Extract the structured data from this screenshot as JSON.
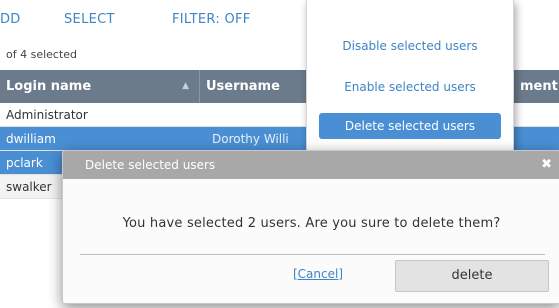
{
  "toolbar": {
    "add_label": "DD",
    "select_label": "SELECT",
    "filter_label": "FILTER: OFF"
  },
  "selection": {
    "count_text": "of 4 selected"
  },
  "table": {
    "columns": [
      "Login name",
      "Username",
      "ment"
    ],
    "sort_indicator": "▲",
    "rows": [
      {
        "login": "Administrator",
        "username": ""
      },
      {
        "login": "dwilliam",
        "username": "Dorothy Willi"
      },
      {
        "login": "pclark",
        "username": ""
      },
      {
        "login": "swalker",
        "username": ""
      }
    ]
  },
  "dropdown": {
    "items": [
      "Disable selected users",
      "Enable selected users",
      "Delete selected users"
    ]
  },
  "modal": {
    "title": "Delete selected users",
    "close_glyph": "✖",
    "message": "You have selected 2 users. Are you sure to delete them?",
    "cancel_label": "[Cancel]",
    "delete_label": "delete"
  }
}
